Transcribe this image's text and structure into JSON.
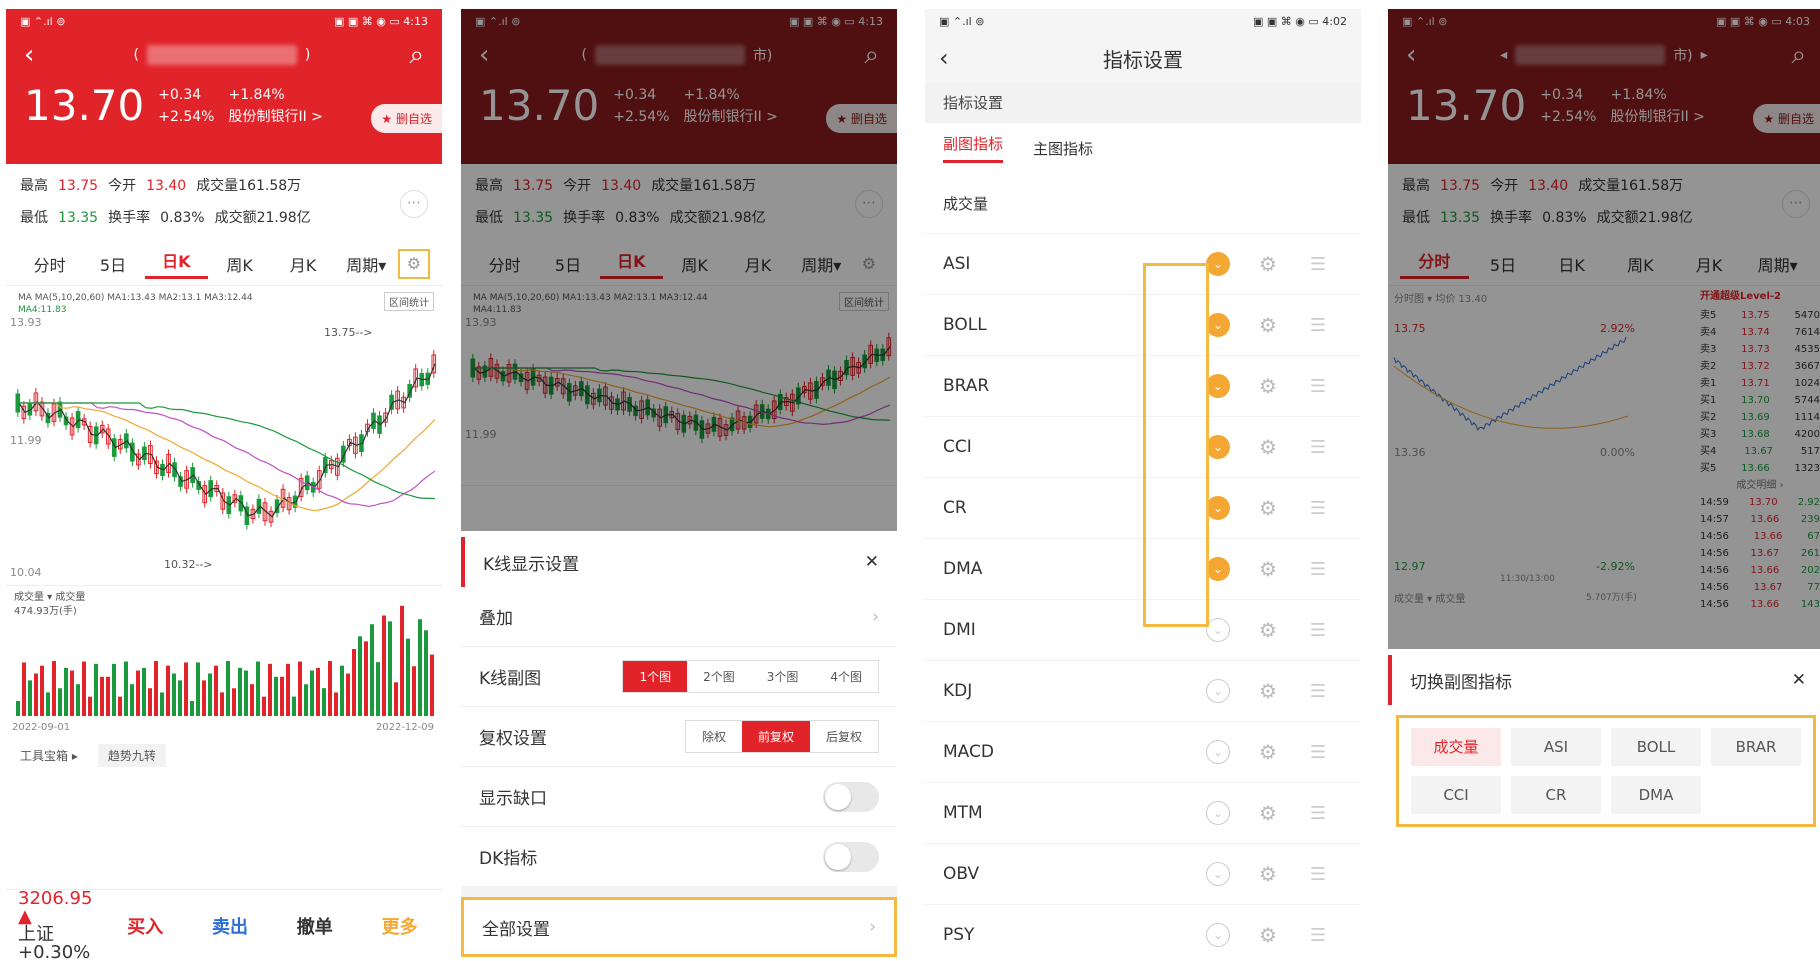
{
  "status": {
    "left": "▣ ⌃.ıl ⊚",
    "right1": "▣ ▣ ⌘ ◉ ▭ 4:13",
    "right3": "▣ ▣ ⌘ ◉ ▭ 4:02",
    "right4": "▣ ▣ ⌘ ◉ ▭ 4:03"
  },
  "quote": {
    "price": "13.70",
    "chg": "+0.34",
    "chgpct": "+2.54%",
    "pct": "+1.84%",
    "sector": "股份制银行II >",
    "fav": "★ 删自选",
    "paren_l": "(",
    "paren_r": ")",
    "p2_tail": "市)"
  },
  "stats": {
    "hi_l": "最高",
    "hi": "13.75",
    "open_l": "今开",
    "open": "13.40",
    "vol": "成交量161.58万",
    "lo_l": "最低",
    "lo": "13.35",
    "turn_l": "换手率",
    "turn": "0.83%",
    "amt": "成交额21.98亿"
  },
  "tabs": [
    "分时",
    "5日",
    "日K",
    "周K",
    "月K",
    "周期▾"
  ],
  "chart": {
    "ma": "MA",
    "ma_legend": "MA(5,10,20,60) MA1:13.43 MA2:13.1 MA3:12.44",
    "ma4": "MA4:11.83",
    "tag": "区间统计",
    "y_top": "13.93",
    "y_mid": "11.99",
    "y_bot": "10.04",
    "hi_mark": "13.75-->",
    "lo_mark": "10.32-->",
    "vol_l": "成交量 ▾   成交量",
    "vol_v": "474.93万(手)",
    "d_start": "2022-09-01",
    "d_end": "2022-12-09"
  },
  "tools": {
    "a": "工具宝箱 ▸",
    "b": "趋势九转"
  },
  "trade": {
    "idx": "3206.95 ▲",
    "idx2": "上证 +0.30%",
    "buy": "买入",
    "sell": "卖出",
    "cancel": "撤单",
    "more": "更多"
  },
  "sheet": {
    "title": "K线显示设置",
    "overlay": "叠加",
    "sub": "K线副图",
    "subs": [
      "1个图",
      "2个图",
      "3个图",
      "4个图"
    ],
    "fq": "复权设置",
    "fqs": [
      "除权",
      "前复权",
      "后复权"
    ],
    "gap": "显示缺口",
    "dk": "DK指标",
    "all": "全部设置"
  },
  "p3": {
    "title": "指标设置",
    "section": "指标设置",
    "tab_sub": "副图指标",
    "tab_main": "主图指标",
    "items": [
      {
        "name": "成交量",
        "on": null
      },
      {
        "name": "ASI",
        "on": true
      },
      {
        "name": "BOLL",
        "on": true
      },
      {
        "name": "BRAR",
        "on": true
      },
      {
        "name": "CCI",
        "on": true
      },
      {
        "name": "CR",
        "on": true
      },
      {
        "name": "DMA",
        "on": true
      },
      {
        "name": "DMI",
        "on": false
      },
      {
        "name": "KDJ",
        "on": false
      },
      {
        "name": "MACD",
        "on": false
      },
      {
        "name": "MTM",
        "on": false
      },
      {
        "name": "OBV",
        "on": false
      },
      {
        "name": "PSY",
        "on": false
      }
    ]
  },
  "p4": {
    "legend": "分时图 ▾   均价 13.40",
    "level_title": "开通超级Level-2",
    "y_top": "13.75",
    "y_bot": "12.97",
    "pct_top": "2.92%",
    "pct_bot": "-2.92%",
    "mid_l": "13.36",
    "mid_r": "0.00%",
    "vol_l": "成交量 ▾   成交量",
    "vol_v": "5.707万(手)",
    "time_mid": "11:30/13:00",
    "asks": [
      [
        "卖5",
        "13.75",
        "5470"
      ],
      [
        "卖4",
        "13.74",
        "7614"
      ],
      [
        "卖3",
        "13.73",
        "4535"
      ],
      [
        "卖2",
        "13.72",
        "3667"
      ],
      [
        "卖1",
        "13.71",
        "1024"
      ]
    ],
    "bids": [
      [
        "买1",
        "13.70",
        "5744"
      ],
      [
        "买2",
        "13.69",
        "1114"
      ],
      [
        "买3",
        "13.68",
        "4200"
      ],
      [
        "买4",
        "13.67",
        "517"
      ],
      [
        "买5",
        "13.66",
        "1323"
      ]
    ],
    "detail_t": "成交明细 ›",
    "ticks": [
      [
        "14:59",
        "13.70",
        "2.92"
      ],
      [
        "14:57",
        "13.66",
        "239"
      ],
      [
        "14:56",
        "13.66",
        "67"
      ],
      [
        "14:56",
        "13.67",
        "261"
      ],
      [
        "14:56",
        "13.66",
        "202"
      ],
      [
        "14:56",
        "13.67",
        "77"
      ],
      [
        "14:56",
        "13.66",
        "143"
      ]
    ],
    "sheet_title": "切换副图指标",
    "opts": [
      "成交量",
      "ASI",
      "BOLL",
      "BRAR",
      "CCI",
      "CR",
      "DMA"
    ]
  },
  "colors": {
    "red": "#e1242a",
    "green": "#1a9a3c",
    "orange": "#f4b942"
  }
}
